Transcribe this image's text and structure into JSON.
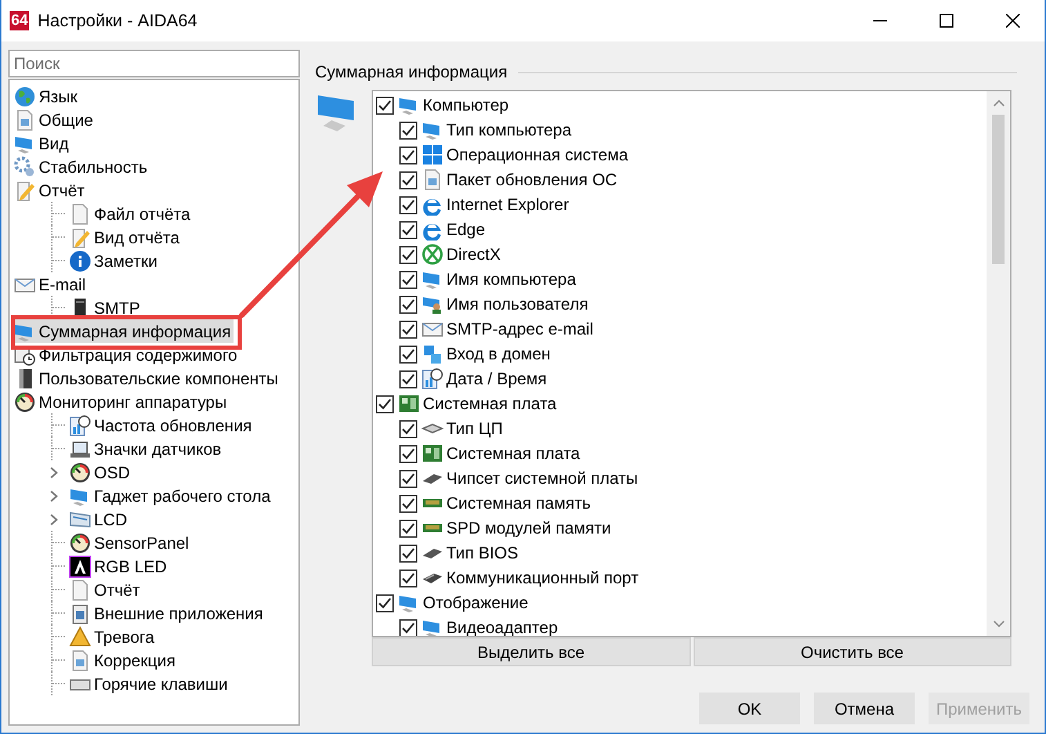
{
  "window": {
    "title": "Настройки - AIDA64",
    "logo": "64"
  },
  "search": {
    "placeholder": "Поиск"
  },
  "tree": [
    {
      "label": "Язык",
      "selected": false
    },
    {
      "label": "Общие",
      "selected": false
    },
    {
      "label": "Вид",
      "selected": false
    },
    {
      "label": "Стабильность",
      "selected": false
    },
    {
      "label": "Отчёт",
      "selected": false,
      "children": [
        {
          "label": "Файл отчёта",
          "selected": false
        },
        {
          "label": "Вид отчёта",
          "selected": false
        },
        {
          "label": "Заметки",
          "selected": false
        }
      ]
    },
    {
      "label": "E-mail",
      "selected": false,
      "children": [
        {
          "label": "SMTP",
          "selected": false
        }
      ]
    },
    {
      "label": "Суммарная информация",
      "selected": true
    },
    {
      "label": "Фильтрация содержимого",
      "selected": false
    },
    {
      "label": "Пользовательские компоненты",
      "selected": false
    },
    {
      "label": "Мониторинг аппаратуры",
      "selected": false,
      "children": [
        {
          "label": "Частота обновления",
          "selected": false
        },
        {
          "label": "Значки датчиков",
          "selected": false
        },
        {
          "label": "OSD",
          "selected": false,
          "expanded": false
        },
        {
          "label": "Гаджет рабочего стола",
          "selected": false,
          "expanded": false
        },
        {
          "label": "LCD",
          "selected": false,
          "expanded": false
        },
        {
          "label": "SensorPanel",
          "selected": false
        },
        {
          "label": "RGB LED",
          "selected": false
        },
        {
          "label": "Отчёт",
          "selected": false
        },
        {
          "label": "Внешние приложения",
          "selected": false
        },
        {
          "label": "Тревога",
          "selected": false
        },
        {
          "label": "Коррекция",
          "selected": false
        },
        {
          "label": "Горячие клавиши",
          "selected": false
        }
      ]
    }
  ],
  "summary": {
    "title": "Суммарная информация",
    "items": [
      {
        "label": "Компьютер",
        "checked": true,
        "children": [
          {
            "label": "Тип компьютера",
            "checked": true
          },
          {
            "label": "Операционная система",
            "checked": true
          },
          {
            "label": "Пакет обновления ОС",
            "checked": true
          },
          {
            "label": "Internet Explorer",
            "checked": true
          },
          {
            "label": "Edge",
            "checked": true
          },
          {
            "label": "DirectX",
            "checked": true
          },
          {
            "label": "Имя компьютера",
            "checked": true
          },
          {
            "label": "Имя пользователя",
            "checked": true
          },
          {
            "label": "SMTP-адрес e-mail",
            "checked": true
          },
          {
            "label": "Вход в домен",
            "checked": true
          },
          {
            "label": "Дата / Время",
            "checked": true
          }
        ]
      },
      {
        "label": "Системная плата",
        "checked": true,
        "children": [
          {
            "label": "Тип ЦП",
            "checked": true
          },
          {
            "label": "Системная плата",
            "checked": true
          },
          {
            "label": "Чипсет системной платы",
            "checked": true
          },
          {
            "label": "Системная память",
            "checked": true
          },
          {
            "label": "SPD модулей памяти",
            "checked": true
          },
          {
            "label": "Тип BIOS",
            "checked": true
          },
          {
            "label": "Коммуникационный порт",
            "checked": true
          }
        ]
      },
      {
        "label": "Отображение",
        "checked": true,
        "children": [
          {
            "label": "Видеоадаптер",
            "checked": true
          }
        ]
      }
    ]
  },
  "list_buttons": [
    "Выделить все",
    "Очистить все"
  ],
  "buttons": [
    {
      "label": "OK",
      "disabled": false
    },
    {
      "label": "Отмена",
      "disabled": false
    },
    {
      "label": "Применить",
      "disabled": true
    }
  ]
}
